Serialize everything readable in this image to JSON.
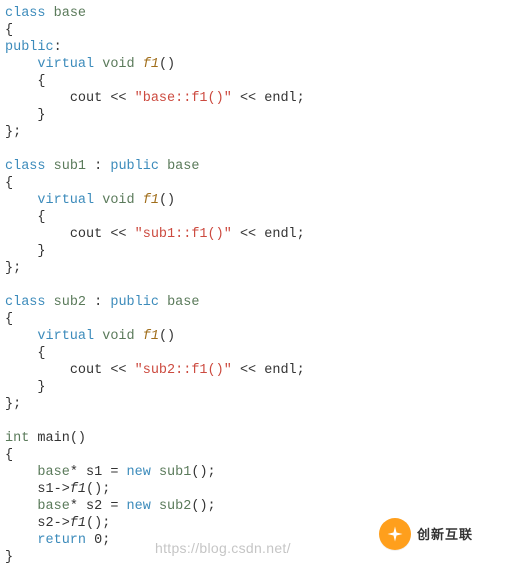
{
  "code": {
    "class_base": {
      "kw_class": "class",
      "name": "base",
      "kw_public": "public",
      "colon": ":",
      "kw_virtual": "virtual",
      "kw_void": "void",
      "fn": "f1",
      "parens": "()",
      "cout_prefix": "cout << ",
      "str": "\"base::f1()\"",
      "cout_suffix": " << endl;"
    },
    "class_sub1": {
      "kw_class": "class",
      "name": "sub1",
      "kw_public": "public",
      "base_name": "base",
      "kw_virtual": "virtual",
      "kw_void": "void",
      "fn": "f1",
      "parens": "()",
      "cout_prefix": "cout << ",
      "str": "\"sub1::f1()\"",
      "cout_suffix": " << endl;"
    },
    "class_sub2": {
      "kw_class": "class",
      "name": "sub2",
      "kw_public": "public",
      "base_name": "base",
      "kw_virtual": "virtual",
      "kw_void": "void",
      "fn": "f1",
      "parens": "()",
      "cout_prefix": "cout << ",
      "str": "\"sub2::f1()\"",
      "cout_suffix": " << endl;"
    },
    "main_fn": {
      "kw_int": "int",
      "name": "main",
      "parens": "()",
      "line1": {
        "type": "base",
        "star_var": "* s1 = ",
        "kw_new": "new",
        "ctor": "sub1",
        "tail": "();"
      },
      "line2": {
        "obj_arrow": "s1->",
        "fn": "f1",
        "tail": "();"
      },
      "line3": {
        "type": "base",
        "star_var": "* s2 = ",
        "kw_new": "new",
        "ctor": "sub2",
        "tail": "();"
      },
      "line4": {
        "obj_arrow": "s2->",
        "fn": "f1",
        "tail": "();"
      },
      "line5": {
        "kw_return": "return",
        "val": " 0;"
      }
    }
  },
  "watermark": {
    "url": "https://blog.csdn.net/",
    "brand": "创新互联"
  }
}
